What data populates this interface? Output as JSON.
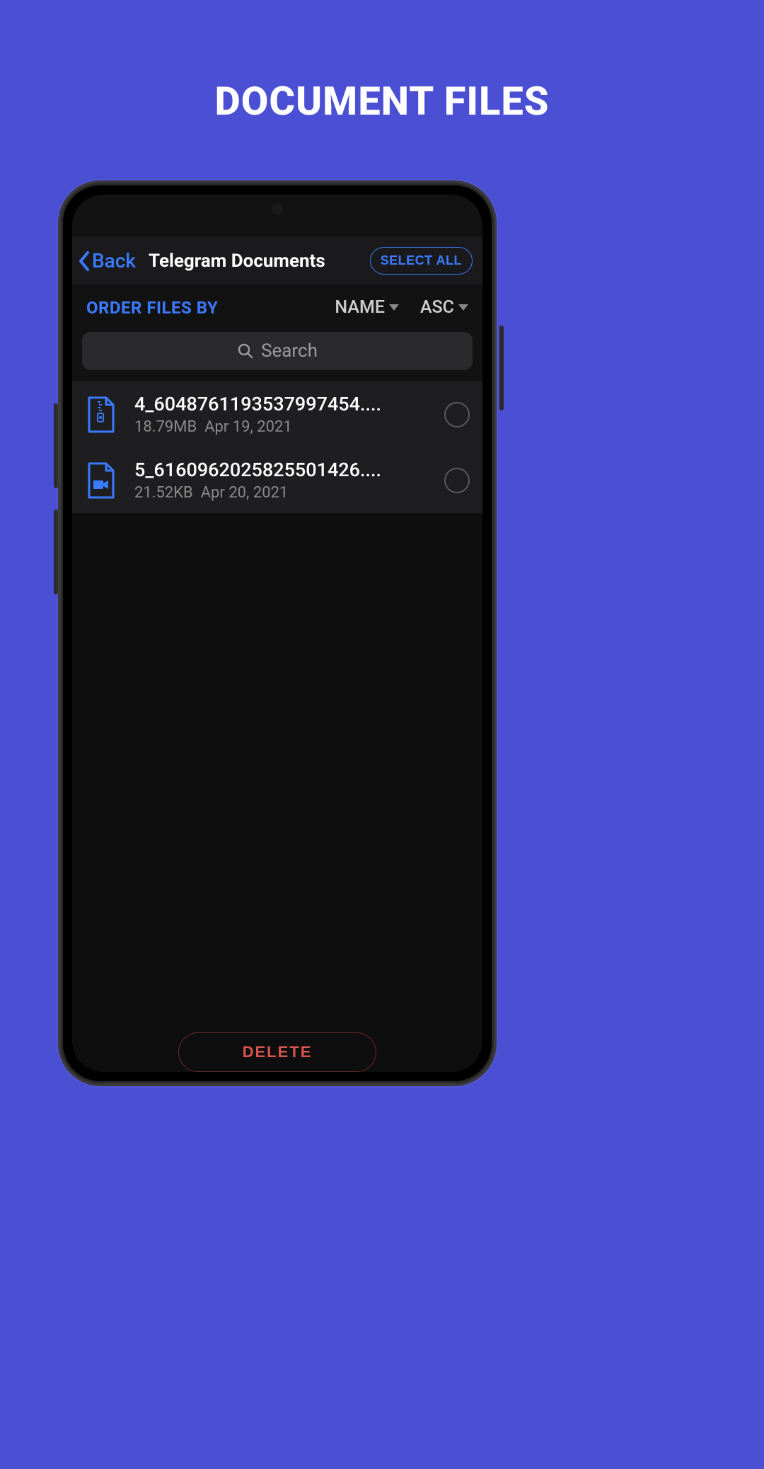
{
  "page": {
    "title": "DOCUMENT FILES"
  },
  "header": {
    "back_label": "Back",
    "title": "Telegram Documents",
    "select_all_label": "SELECT ALL"
  },
  "sort": {
    "order_label": "ORDER FILES BY",
    "field": "NAME",
    "direction": "ASC"
  },
  "search": {
    "placeholder": "Search"
  },
  "files": [
    {
      "icon": "zip-file-icon",
      "name": "4_6048761193537997454....",
      "size": "18.79MB",
      "date": "Apr 19, 2021"
    },
    {
      "icon": "video-file-icon",
      "name": "5_6160962025825501426....",
      "size": "21.52KB",
      "date": "Apr 20, 2021"
    }
  ],
  "actions": {
    "delete_label": "DELETE"
  },
  "colors": {
    "accent": "#3b7bff",
    "danger": "#d9534f",
    "background": "#4a4fd4"
  }
}
